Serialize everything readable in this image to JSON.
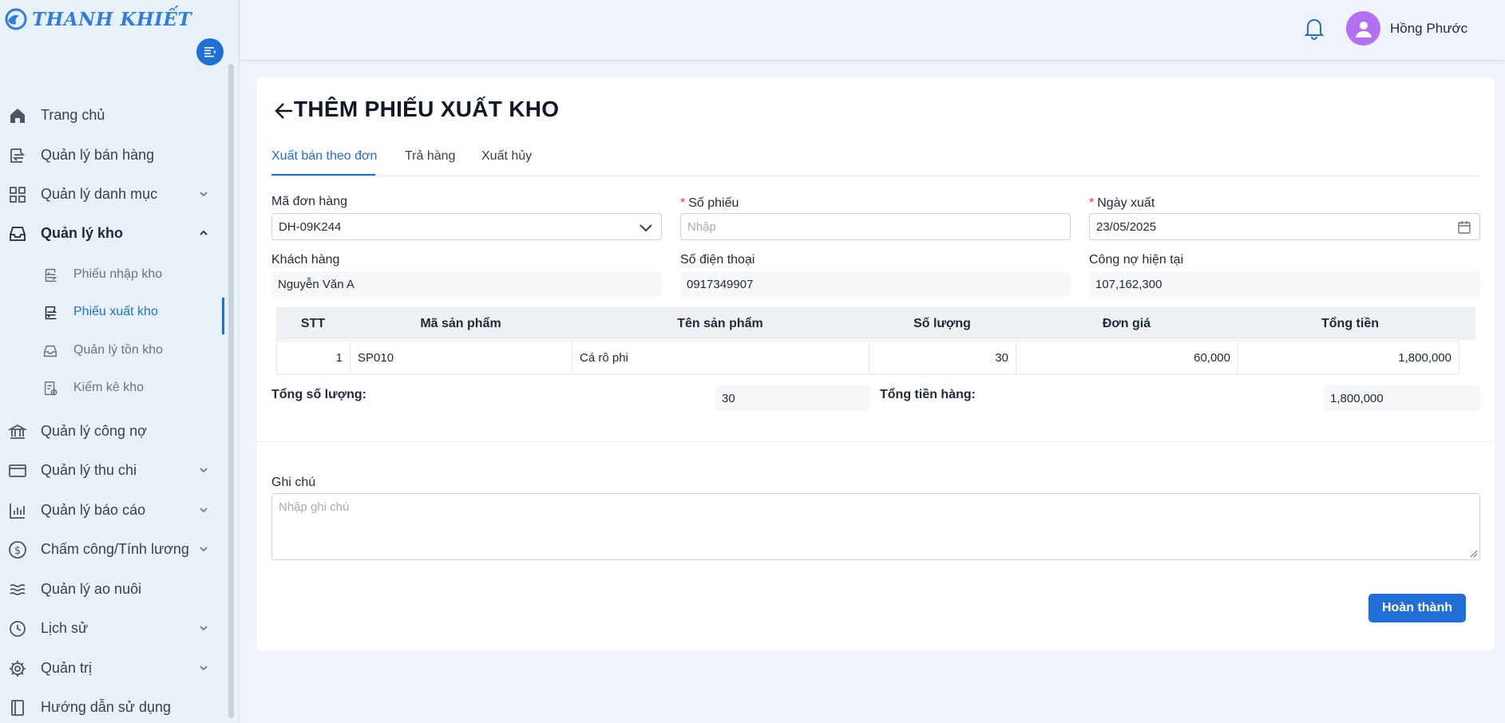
{
  "brand": {
    "name": "THANH KHIẾT"
  },
  "header": {
    "username": "Hồng Phước"
  },
  "sidebar": {
    "items": [
      {
        "label": "Trang chủ"
      },
      {
        "label": "Quản lý bán hàng"
      },
      {
        "label": "Quản lý danh mục"
      },
      {
        "label": "Quản lý kho"
      },
      {
        "label": "Quản lý công nợ"
      },
      {
        "label": "Quản lý thu chi"
      },
      {
        "label": "Quản lý báo cáo"
      },
      {
        "label": "Chấm công/Tính lương"
      },
      {
        "label": "Quản lý ao nuôi"
      },
      {
        "label": "Lịch sử"
      },
      {
        "label": "Quản trị"
      },
      {
        "label": "Hướng dẫn sử dụng"
      }
    ],
    "kho_sub": [
      {
        "label": "Phiếu nhập kho"
      },
      {
        "label": "Phiếu xuất kho"
      },
      {
        "label": "Quản lý tồn kho"
      },
      {
        "label": "Kiểm kê kho"
      }
    ]
  },
  "page": {
    "title": "THÊM PHIẾU XUẤT KHO",
    "tabs": [
      {
        "label": "Xuất bán theo đơn"
      },
      {
        "label": "Trả hàng"
      },
      {
        "label": "Xuất hủy"
      }
    ],
    "active_tab": "Xuất bán theo đơn"
  },
  "form": {
    "order_label": "Mã đơn hàng",
    "order_value": "DH-09K244",
    "slip_label": "Số phiếu",
    "slip_placeholder": "Nhập",
    "date_label": "Ngày xuất",
    "date_value": "23/05/2025",
    "customer_label": "Khách hàng",
    "customer_value": "Nguyễn Văn A",
    "phone_label": "Số điện thoại",
    "phone_value": "0917349907",
    "debt_label": "Công nợ hiện tại",
    "debt_value": "107,162,300"
  },
  "table": {
    "headers": [
      "STT",
      "Mã sản phẩm",
      "Tên sản phẩm",
      "Số lượng",
      "Đơn giá",
      "Tổng tiền"
    ],
    "rows": [
      {
        "stt": "1",
        "code": "SP010",
        "name": "Cá rô phi",
        "qty": "30",
        "price": "60,000",
        "total": "1,800,000"
      }
    ]
  },
  "summary": {
    "qty_label": "Tổng số lượng:",
    "qty_value": "30",
    "amount_label": "Tổng tiền hàng:",
    "amount_value": "1,800,000"
  },
  "note": {
    "label": "Ghi chú",
    "placeholder": "Nhập ghi chú"
  },
  "actions": {
    "submit_label": "Hoàn thành"
  },
  "colors": {
    "primary": "#1f6fd6",
    "brand": "#2f7de1",
    "avatar": "#b36ef2",
    "required": "#e53935"
  }
}
